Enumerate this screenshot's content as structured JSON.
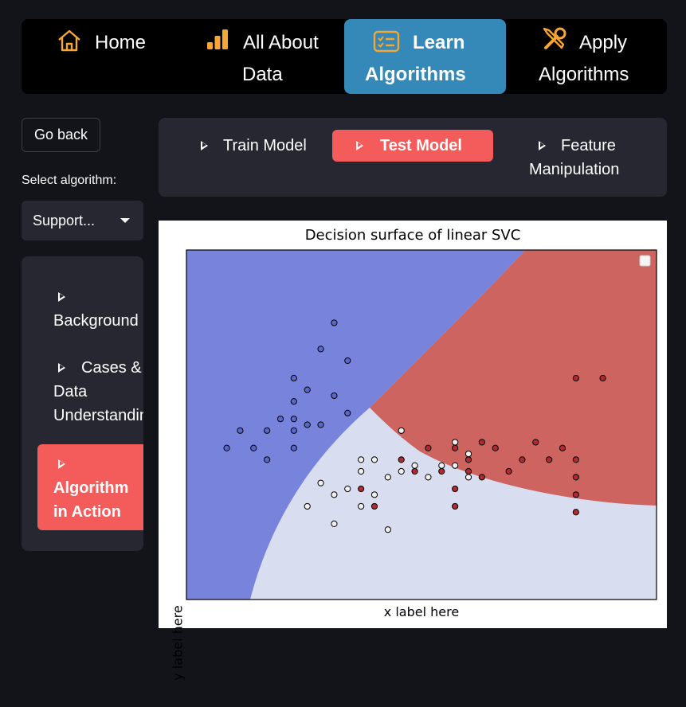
{
  "nav": {
    "items": [
      {
        "line1": "Home",
        "line2": "",
        "icon": "home-icon"
      },
      {
        "line1": "All About",
        "line2": "Data",
        "icon": "bar-chart-icon"
      },
      {
        "line1": "Learn",
        "line2": "Algorithms",
        "icon": "checklist-icon",
        "active": true
      },
      {
        "line1": "Apply",
        "line2": "Algorithms",
        "icon": "tools-icon"
      }
    ],
    "icon_color": "#f7a533",
    "active_color": "#3489b8"
  },
  "sidebar": {
    "go_back": "Go back",
    "select_label": "Select algorithm:",
    "select_value": "Support...",
    "menu": [
      {
        "line1": "",
        "line2": "Background"
      },
      {
        "line1": "Cases &",
        "line2": "Data",
        "line3": "Understandin"
      },
      {
        "line1": "",
        "line2": "Algorithm",
        "line3": "in Action",
        "active": true
      }
    ]
  },
  "tabs": {
    "items": [
      {
        "line1": "Train Model",
        "line2": ""
      },
      {
        "line1": "Test Model",
        "line2": "",
        "active": true
      },
      {
        "line1": "Feature",
        "line2": "Manipulation"
      }
    ],
    "active_color": "#f45b5b"
  },
  "chart_data": {
    "type": "scatter",
    "title": "Decision surface of linear SVC",
    "xlabel": "x label here",
    "ylabel": "y label here",
    "region_colors": {
      "class_0": "#7884dc",
      "class_1": "#cd6460",
      "class_2": "#d8def0"
    },
    "legend": {
      "placement": "top-right",
      "entries": []
    },
    "axis_ticks": "hidden",
    "series": [
      {
        "color": "#5c68c8",
        "points": [
          [
            11,
            8.5
          ],
          [
            10,
            7.6
          ],
          [
            12,
            7.2
          ],
          [
            8,
            6.6
          ],
          [
            9,
            6.2
          ],
          [
            11,
            6.0
          ],
          [
            8,
            5.8
          ],
          [
            7,
            5.2
          ],
          [
            8,
            5.2
          ],
          [
            9,
            5.0
          ],
          [
            10,
            5.0
          ],
          [
            4,
            4.8
          ],
          [
            6,
            4.8
          ],
          [
            8,
            4.8
          ],
          [
            12,
            5.4
          ],
          [
            5,
            4.2
          ],
          [
            3,
            4.2
          ],
          [
            8,
            4.2
          ],
          [
            6,
            3.8
          ]
        ]
      },
      {
        "color": "#b02a30",
        "points": [
          [
            29,
            6.6
          ],
          [
            31,
            6.6
          ],
          [
            18,
            4.2
          ],
          [
            20,
            4.2
          ],
          [
            22,
            4.4
          ],
          [
            23,
            4.2
          ],
          [
            26,
            4.4
          ],
          [
            28,
            4.2
          ],
          [
            27,
            3.8
          ],
          [
            21,
            3.8
          ],
          [
            22,
            3.2
          ],
          [
            25,
            3.8
          ],
          [
            29,
            3.8
          ],
          [
            16,
            3.8
          ],
          [
            17,
            3.4
          ],
          [
            19,
            3.4
          ],
          [
            21,
            3.4
          ],
          [
            24,
            3.4
          ],
          [
            29,
            3.2
          ],
          [
            29,
            2.6
          ],
          [
            13,
            2.8
          ],
          [
            20,
            2.8
          ],
          [
            14,
            2.2
          ],
          [
            20,
            2.2
          ],
          [
            29,
            2.0
          ]
        ]
      },
      {
        "color": "#f0f0f0",
        "points": [
          [
            16,
            4.8
          ],
          [
            20,
            4.4
          ],
          [
            21,
            4.0
          ],
          [
            13,
            3.8
          ],
          [
            14,
            3.8
          ],
          [
            16,
            3.4
          ],
          [
            13,
            3.4
          ],
          [
            15,
            3.2
          ],
          [
            18,
            3.2
          ],
          [
            19,
            3.6
          ],
          [
            17,
            3.6
          ],
          [
            20,
            3.6
          ],
          [
            21,
            3.2
          ],
          [
            10,
            3.0
          ],
          [
            12,
            2.8
          ],
          [
            11,
            2.6
          ],
          [
            14,
            2.6
          ],
          [
            9,
            2.2
          ],
          [
            13,
            2.2
          ],
          [
            11,
            1.6
          ],
          [
            15,
            1.4
          ]
        ]
      }
    ],
    "xlim": [
      0,
      35
    ],
    "ylim": [
      -1,
      11
    ]
  }
}
